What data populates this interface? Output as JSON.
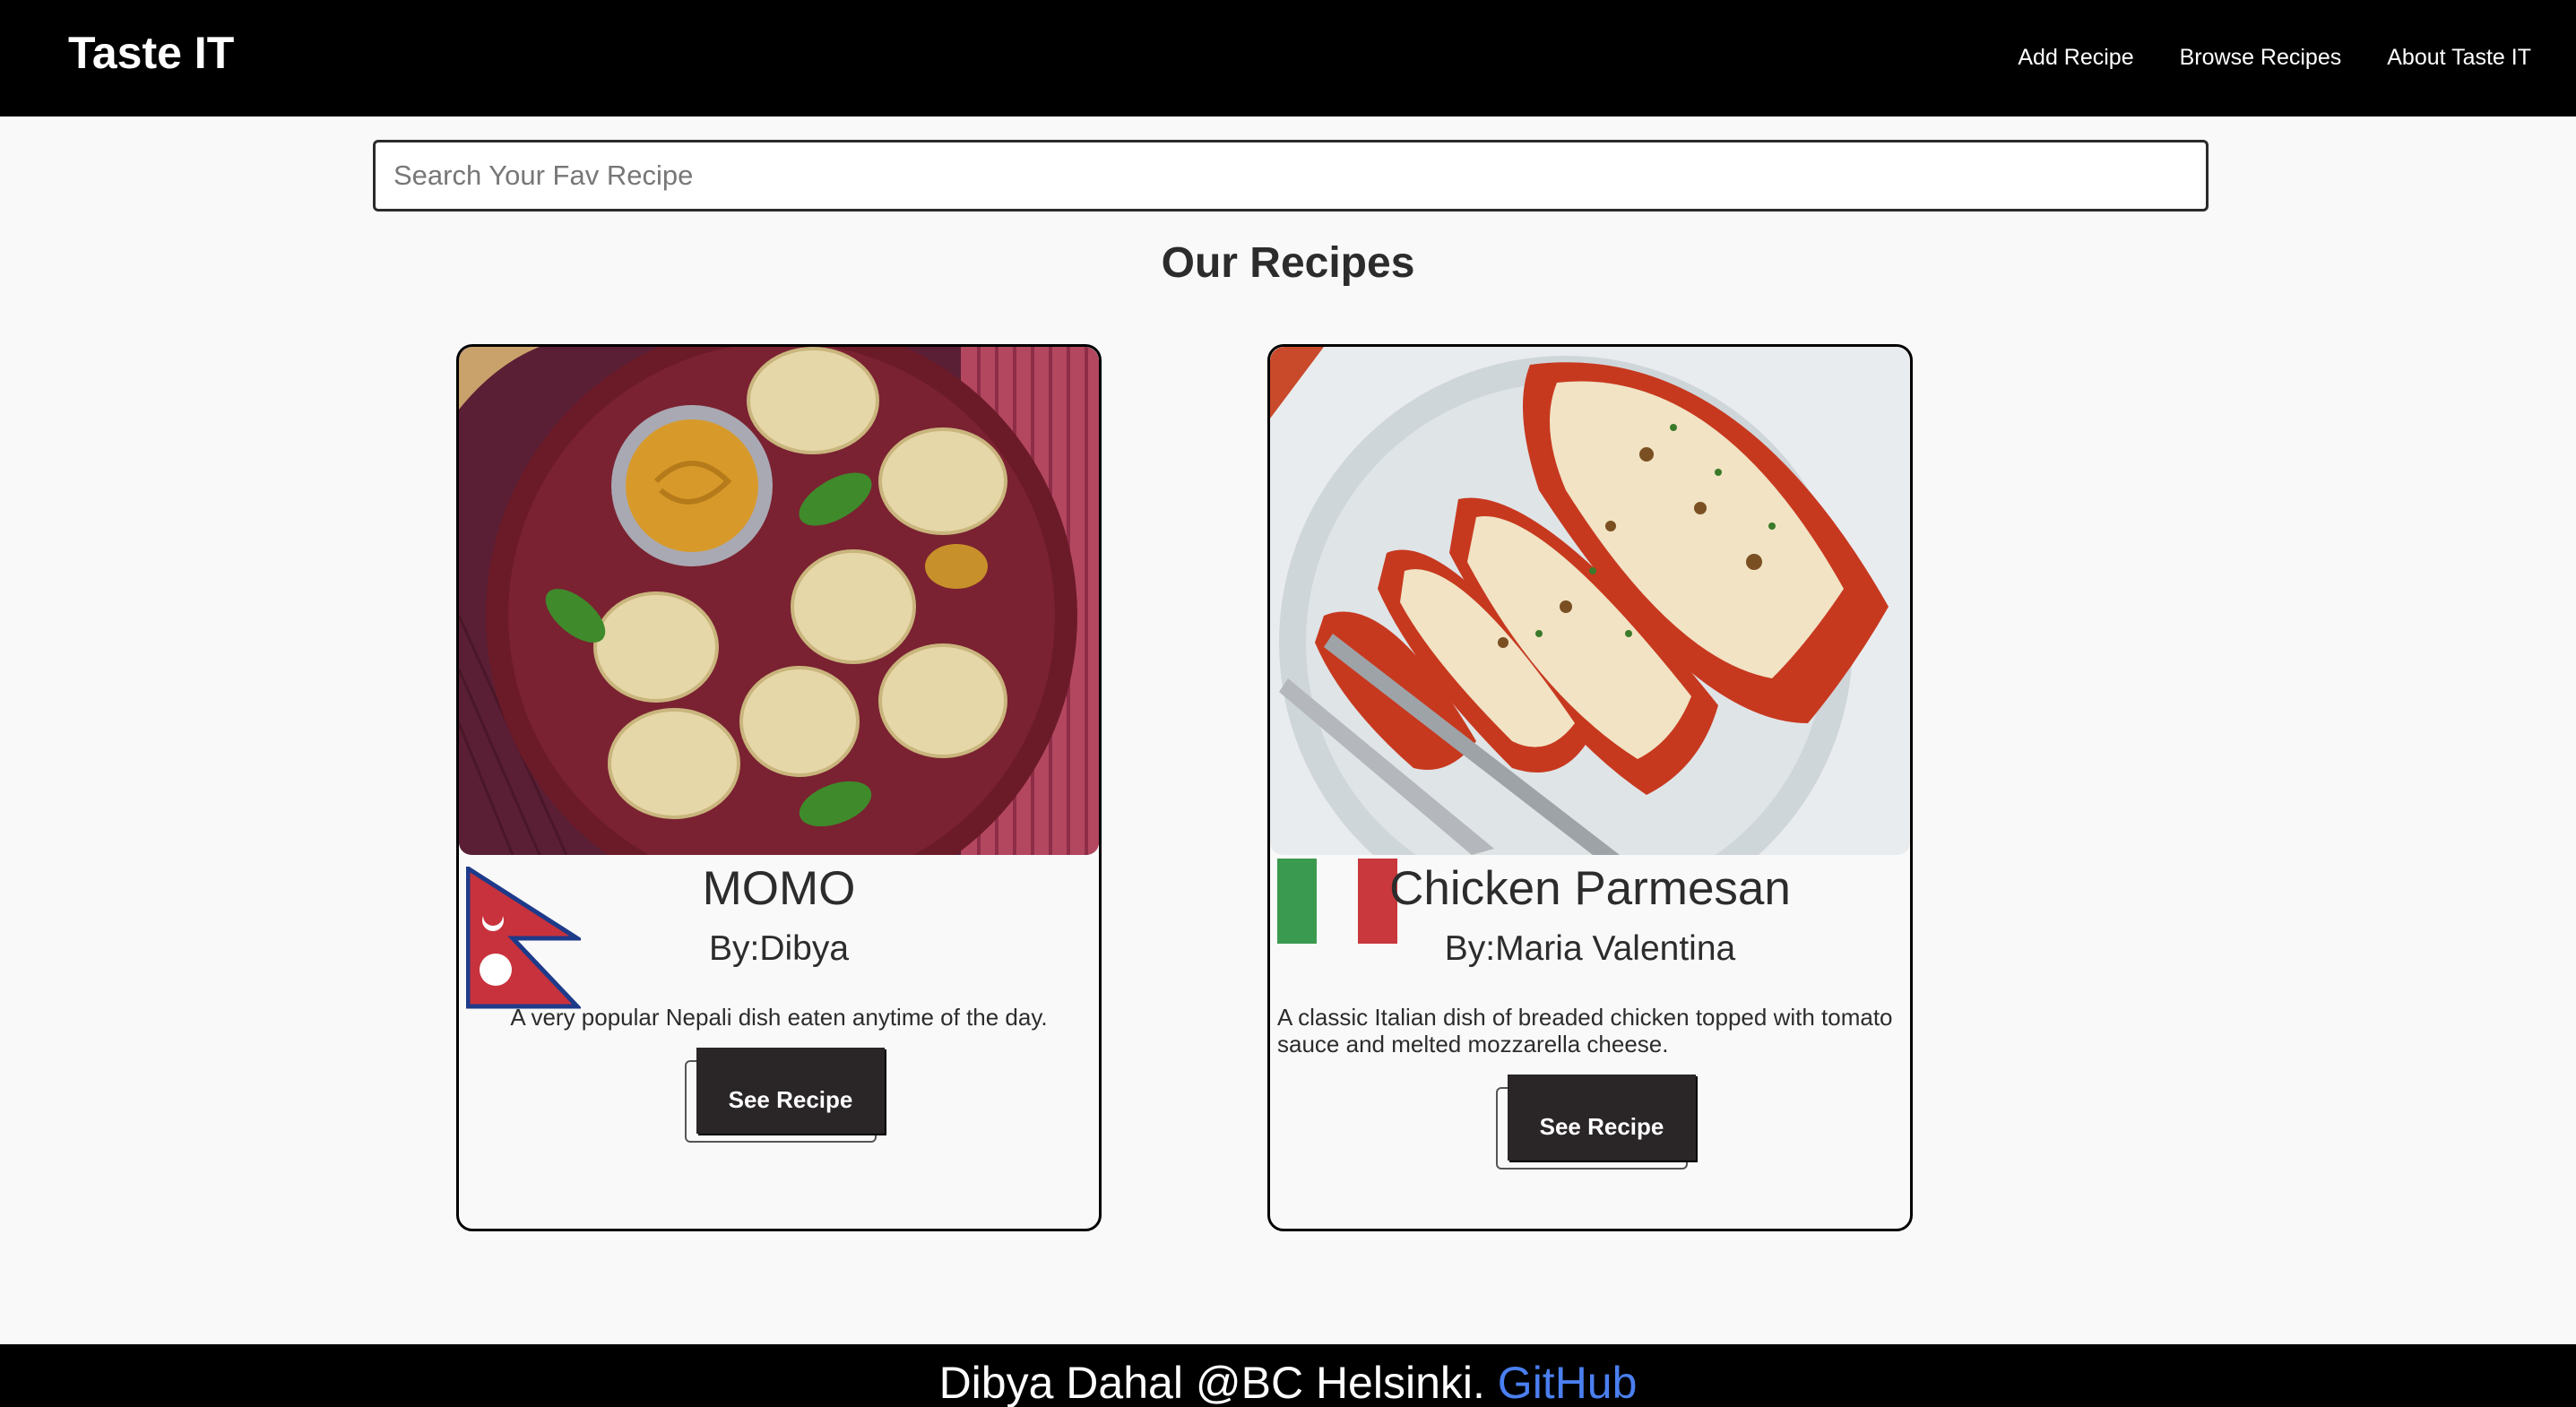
{
  "header": {
    "brand": "Taste IT",
    "nav": [
      "Add Recipe",
      "Browse Recipes",
      "About Taste IT"
    ]
  },
  "search": {
    "placeholder": "Search Your Fav Recipe",
    "value": ""
  },
  "section_title": "Our Recipes",
  "recipes": [
    {
      "title": "MOMO",
      "author": "By:Dibya",
      "description": "A very popular Nepali dish eaten anytime of the day.",
      "button": "See Recipe",
      "flag_icon": "nepal-flag-icon",
      "image_icon": "momo-dumplings-image"
    },
    {
      "title": "Chicken Parmesan",
      "author": "By:Maria Valentina",
      "description": "A classic Italian dish of breaded chicken topped with tomato sauce and melted mozzarella cheese.",
      "button": "See Recipe",
      "flag_icon": "italy-flag-icon",
      "image_icon": "chicken-parmesan-image"
    }
  ],
  "footer": {
    "text": "Dibya Dahal @BC Helsinki.",
    "link": "GitHub",
    "link_color": "#4a7ff0"
  },
  "colors": {
    "header_bg": "#000000",
    "page_bg": "#f9f9f9",
    "button_bg": "#2a2526",
    "nepal_red": "#c8323c",
    "nepal_blue": "#1e3a8a",
    "italy_green": "#3a9a4f",
    "italy_red": "#c8383c"
  }
}
